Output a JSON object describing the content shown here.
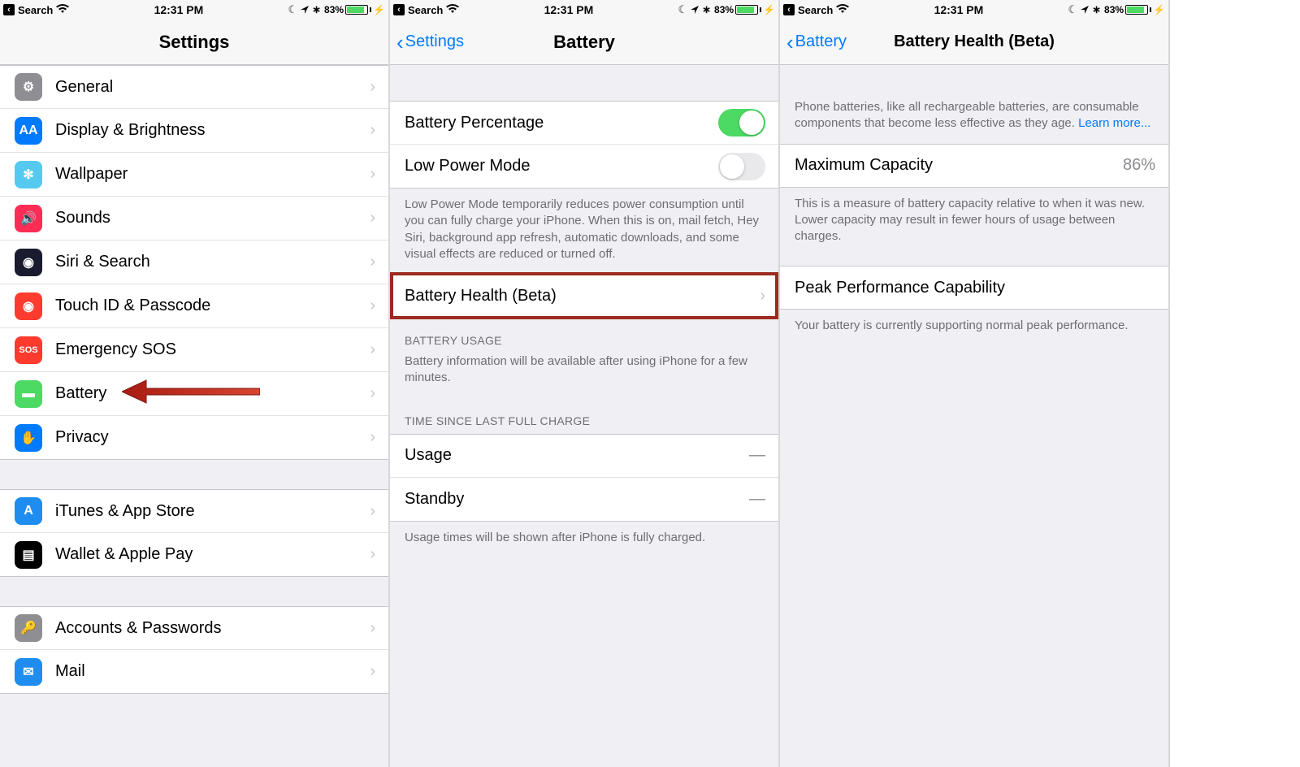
{
  "status": {
    "back_label": "Search",
    "time": "12:31 PM",
    "battery_pct": "83%"
  },
  "screen1": {
    "title": "Settings",
    "items_a": [
      {
        "label": "General",
        "icon": "ic-general",
        "glyph": "⚙"
      },
      {
        "label": "Display & Brightness",
        "icon": "ic-display",
        "glyph": "AA"
      },
      {
        "label": "Wallpaper",
        "icon": "ic-wallpaper",
        "glyph": "✻"
      },
      {
        "label": "Sounds",
        "icon": "ic-sounds",
        "glyph": "🔊"
      },
      {
        "label": "Siri & Search",
        "icon": "ic-siri",
        "glyph": "◉"
      },
      {
        "label": "Touch ID & Passcode",
        "icon": "ic-touchid",
        "glyph": "◉"
      },
      {
        "label": "Emergency SOS",
        "icon": "ic-sos",
        "glyph": "SOS"
      },
      {
        "label": "Battery",
        "icon": "ic-battery",
        "glyph": "▬"
      },
      {
        "label": "Privacy",
        "icon": "ic-privacy",
        "glyph": "✋"
      }
    ],
    "items_b": [
      {
        "label": "iTunes & App Store",
        "icon": "ic-itunes",
        "glyph": "A"
      },
      {
        "label": "Wallet & Apple Pay",
        "icon": "ic-wallet",
        "glyph": "▤"
      }
    ],
    "items_c": [
      {
        "label": "Accounts & Passwords",
        "icon": "ic-accounts",
        "glyph": "🔑"
      },
      {
        "label": "Mail",
        "icon": "ic-mail",
        "glyph": "✉"
      }
    ]
  },
  "screen2": {
    "back": "Settings",
    "title": "Battery",
    "row_pct": "Battery Percentage",
    "row_lpm": "Low Power Mode",
    "lpm_note": "Low Power Mode temporarily reduces power consumption until you can fully charge your iPhone. When this is on, mail fetch, Hey Siri, background app refresh, automatic downloads, and some visual effects are reduced or turned off.",
    "row_health": "Battery Health (Beta)",
    "usage_header": "BATTERY USAGE",
    "usage_note": "Battery information will be available after using iPhone for a few minutes.",
    "time_header": "TIME SINCE LAST FULL CHARGE",
    "row_usage": "Usage",
    "row_standby": "Standby",
    "dash": "—",
    "time_note": "Usage times will be shown after iPhone is fully charged."
  },
  "screen3": {
    "back": "Battery",
    "title": "Battery Health (Beta)",
    "intro": "Phone batteries, like all rechargeable batteries, are consumable components that become less effective as they age. ",
    "learn_more": "Learn more...",
    "row_capacity": "Maximum Capacity",
    "capacity_value": "86%",
    "capacity_note": "This is a measure of battery capacity relative to when it was new. Lower capacity may result in fewer hours of usage between charges.",
    "row_peak": "Peak Performance Capability",
    "peak_note": "Your battery is currently supporting normal peak performance."
  }
}
